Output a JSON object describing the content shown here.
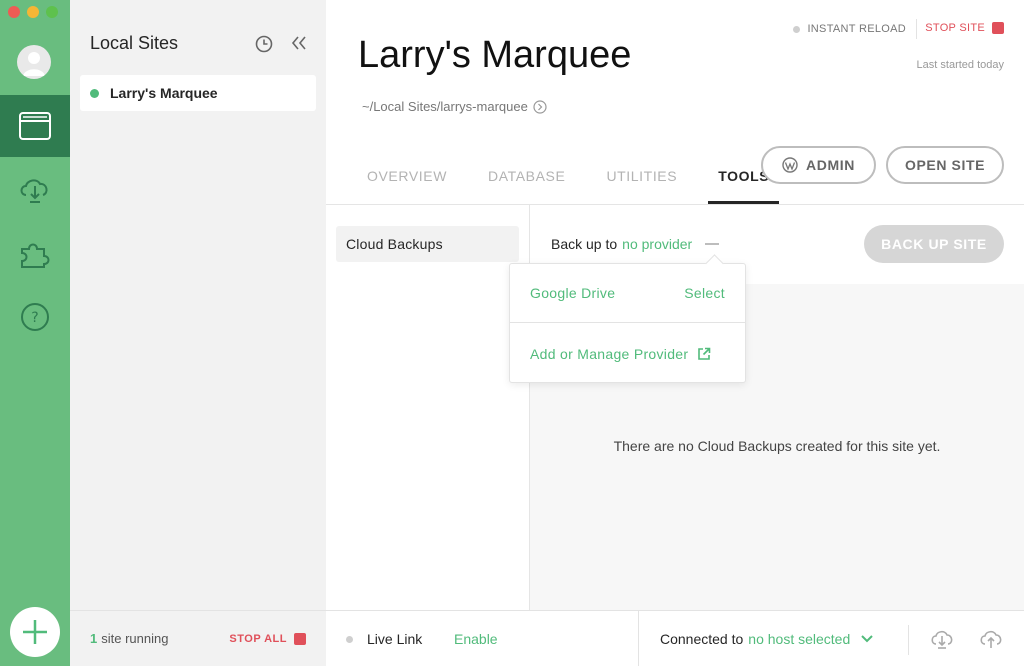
{
  "sidebar": {
    "title": "Local Sites",
    "sites": [
      {
        "name": "Larry's Marquee",
        "status_color": "#51bb7b"
      }
    ],
    "footer": {
      "running_count": "1",
      "running_label": "site running",
      "stop_all_label": "STOP ALL"
    }
  },
  "header": {
    "instant_reload_label": "INSTANT RELOAD",
    "stop_site_label": "STOP SITE",
    "last_started": "Last started today",
    "site_title": "Larry's Marquee",
    "site_path": "~/Local Sites/larrys-marquee"
  },
  "tabs": [
    {
      "label": "OVERVIEW",
      "active": false
    },
    {
      "label": "DATABASE",
      "active": false
    },
    {
      "label": "UTILITIES",
      "active": false
    },
    {
      "label": "TOOLS",
      "active": true
    }
  ],
  "buttons": {
    "admin": "ADMIN",
    "open_site": "OPEN SITE",
    "back_up_site": "BACK UP SITE"
  },
  "tools": {
    "nav_items": [
      "Cloud Backups"
    ],
    "backup_prefix": "Back up to",
    "backup_provider": "no provider",
    "empty_message": "There are no Cloud Backups created for this site yet.",
    "dropdown": {
      "provider_name": "Google Drive",
      "provider_action": "Select",
      "manage_label": "Add or Manage Provider"
    }
  },
  "footer": {
    "live_link_label": "Live Link",
    "enable_label": "Enable",
    "connected_prefix": "Connected to",
    "host_value": "no host selected"
  },
  "colors": {
    "rail": "#69bd7f",
    "rail_active": "#2f7c50",
    "accent_green": "#51bb7b",
    "stop_red": "#e0505a"
  }
}
